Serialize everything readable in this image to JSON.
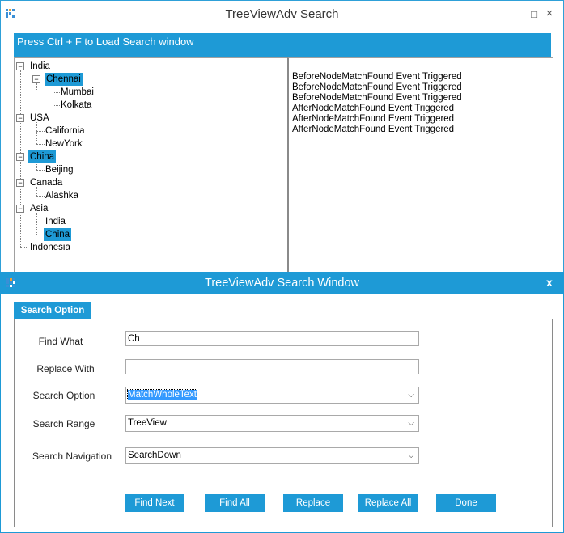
{
  "main_window": {
    "title": "TreeViewAdv Search",
    "controls": {
      "minimize": "–",
      "maximize": "□",
      "close": "×"
    }
  },
  "banner": {
    "text": "Press Ctrl + F to Load Search window"
  },
  "tree": {
    "nodes": [
      {
        "label": "India",
        "selected": false
      },
      {
        "label": "Chennai",
        "selected": true
      },
      {
        "label": "Mumbai",
        "selected": false
      },
      {
        "label": "Kolkata",
        "selected": false
      },
      {
        "label": "USA",
        "selected": false
      },
      {
        "label": "California",
        "selected": false
      },
      {
        "label": "NewYork",
        "selected": false
      },
      {
        "label": "China",
        "selected": true
      },
      {
        "label": "Beijing",
        "selected": false
      },
      {
        "label": "Canada",
        "selected": false
      },
      {
        "label": "Alashka",
        "selected": false
      },
      {
        "label": "Asia",
        "selected": false
      },
      {
        "label": "India",
        "selected": false
      },
      {
        "label": "China",
        "selected": true
      },
      {
        "label": "Indonesia",
        "selected": false
      }
    ],
    "expander_glyph": "−"
  },
  "log": {
    "lines": [
      "BeforeNodeMatchFound Event Triggered",
      "BeforeNodeMatchFound Event Triggered",
      "BeforeNodeMatchFound Event Triggered",
      "AfterNodeMatchFound Event Triggered",
      "AfterNodeMatchFound Event Triggered",
      "AfterNodeMatchFound Event Triggered"
    ]
  },
  "search_window": {
    "title": "TreeViewAdv Search Window",
    "close": "x",
    "tab": "Search Option",
    "fields": {
      "find_what": {
        "label": "Find What",
        "value": "Ch"
      },
      "replace_with": {
        "label": "Replace With",
        "value": ""
      },
      "search_option": {
        "label": "Search Option",
        "value": "MatchWholeText"
      },
      "search_range": {
        "label": "Search Range",
        "value": "TreeView"
      },
      "search_navigation": {
        "label": "Search Navigation",
        "value": "SearchDown"
      }
    },
    "combo_arrow": "⌵",
    "buttons": {
      "find_next": "Find Next",
      "find_all": "Find All",
      "replace": "Replace",
      "replace_all": "Replace All",
      "done": "Done"
    }
  },
  "colors": {
    "accent": "#1e9ad6",
    "selection": "#3399ff"
  }
}
